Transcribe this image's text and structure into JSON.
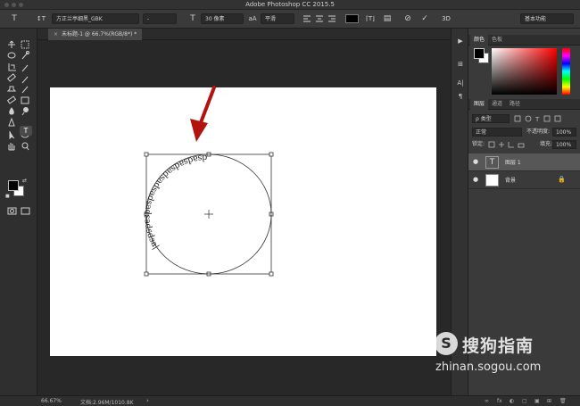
{
  "app": {
    "title": "Adobe Photoshop CC 2015.5"
  },
  "options": {
    "tool_icon": "T",
    "orient_icon": "↕T",
    "font_family": "方正兰亭细黑_GBK",
    "font_style": "-",
    "size_icon": "T",
    "font_size": "30 像素",
    "aa_icon": "aA",
    "antialias": "平滑",
    "warp_icon": "⌈T⌋",
    "char_panel_icon": "▤",
    "cancel_icon": "⊘",
    "commit_icon": "✓",
    "3d_icon": "3D",
    "workspace": "基本功能",
    "text_color": "#000000"
  },
  "document": {
    "tab_title": "未标题-1 @ 66.7%(RGB/8*) *",
    "close_glyph": "×",
    "path_text": "dsadsadsadsadsadsadsadsdsa|"
  },
  "status": {
    "zoom": "66.67%",
    "doc_size": "文档:2.96M/1010.8K",
    "arrow": "›"
  },
  "panels": {
    "color_tabs": [
      "颜色",
      "色板"
    ],
    "layers_tabs": [
      "图层",
      "通道",
      "路径"
    ],
    "filter_kind": "ρ 类型",
    "blend_mode": "正常",
    "opacity_label": "不透明度:",
    "opacity": "100%",
    "lock_label": "锁定:",
    "fill_label": "填充:",
    "fill": "100%",
    "layers": [
      {
        "name": "图层 1",
        "type": "text",
        "thumb": "T",
        "eye": "●"
      },
      {
        "name": "背景",
        "type": "background",
        "thumb": "",
        "eye": "●",
        "lock": "🔒"
      }
    ],
    "footer_icons": [
      "∞",
      "fx",
      "◐",
      "▢",
      "▣",
      "⊞",
      "🗑"
    ]
  },
  "midbar": {
    "buttons": [
      "▶",
      "⊞",
      "A|",
      "¶"
    ]
  },
  "watermark": {
    "logo": "S",
    "name": "搜狗指南",
    "url": "zhinan.sogou.com"
  },
  "colors": {
    "accent_arrow": "#b3130f",
    "selected_layer": "#575757"
  }
}
